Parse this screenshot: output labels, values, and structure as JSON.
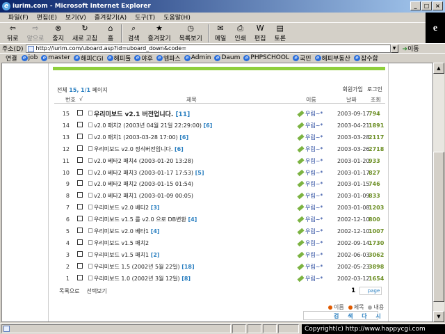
{
  "window": {
    "title": "iurim.com - Microsoft Internet Explorer",
    "icon": "ie-icon"
  },
  "menu": [
    "파일(F)",
    "편집(E)",
    "보기(V)",
    "즐겨찾기(A)",
    "도구(T)",
    "도움말(H)"
  ],
  "toolbar": {
    "back": "뒤로",
    "forward": "앞으로",
    "stop": "중지",
    "refresh": "새로 고침",
    "home": "홈",
    "search": "검색",
    "favorites": "즐겨찾기",
    "history": "목록보기",
    "mail": "메일",
    "print": "인쇄",
    "edit": "편집",
    "discuss": "토론"
  },
  "address": {
    "label": "주소(D)",
    "url": "http://iurim.com/uboard.asp?id=uboard_down&code=",
    "go": "이동"
  },
  "links": {
    "label": "연결",
    "items": [
      "job",
      "master",
      "해피CGI",
      "해피툴",
      "야후",
      "엠파스",
      "Admin",
      "Daum",
      "PHPSCHOOL",
      "국민",
      "해피부동산",
      "잡수함"
    ]
  },
  "board": {
    "summary_prefix": "전체",
    "summary_count": "15,",
    "summary_page": "1/1",
    "summary_suffix": "페이지",
    "top_links": [
      "회원가입",
      "로그인"
    ],
    "headers": {
      "no": "번호",
      "check": "√",
      "subject": "제목",
      "name": "이름",
      "date": "날짜",
      "hit": "조회"
    },
    "rows": [
      {
        "no": "15",
        "subject": "우리미보드 v2.1 버전업니다.",
        "comments": "[11]",
        "name": "우림~*",
        "date": "2003-09-17",
        "hit": "794",
        "bold": true
      },
      {
        "no": "14",
        "subject": "v2.0 패치2 (2003년 04월 21일 22:29:00)",
        "comments": "[6]",
        "name": "우림~*",
        "date": "2003-04-21",
        "hit": "1891"
      },
      {
        "no": "13",
        "subject": "v2.0 패치1 (2003-03-28 17:00)",
        "comments": "[6]",
        "name": "우림~*",
        "date": "2003-03-28",
        "hit": "2117"
      },
      {
        "no": "12",
        "subject": "우리미보드 v2.0 정식버전입니다.",
        "comments": "[6]",
        "name": "우림~*",
        "date": "2003-03-26",
        "hit": "2718"
      },
      {
        "no": "11",
        "subject": "v2.0 베타2 패치4 (2003-01-20 13:28)",
        "comments": "",
        "name": "우림~*",
        "date": "2003-01-20",
        "hit": "933"
      },
      {
        "no": "10",
        "subject": "v2.0 베타2 패치3 (2003-01-17 17:53)",
        "comments": "[5]",
        "name": "우림~*",
        "date": "2003-01-17",
        "hit": "827"
      },
      {
        "no": "9",
        "subject": "v2.0 베타2 패치2 (2003-01-15 01:54)",
        "comments": "",
        "name": "우림~*",
        "date": "2003-01-15",
        "hit": "746"
      },
      {
        "no": "8",
        "subject": "v2.0 베타2 패치1 (2003-01-09 00:05)",
        "comments": "",
        "name": "우림~*",
        "date": "2003-01-09",
        "hit": "833"
      },
      {
        "no": "7",
        "subject": "우리미보드 v2.0 베타2",
        "comments": "[3]",
        "name": "우림~*",
        "date": "2003-01-08",
        "hit": "1203"
      },
      {
        "no": "6",
        "subject": "우리미보드 v1.5 를 v2.0 으로 DB변환",
        "comments": "[4]",
        "name": "우림~*",
        "date": "2002-12-10",
        "hit": "800"
      },
      {
        "no": "5",
        "subject": "우리미보드 v2.0 베타1",
        "comments": "[4]",
        "name": "우림~*",
        "date": "2002-12-10",
        "hit": "1007"
      },
      {
        "no": "4",
        "subject": "우리미보드 v1.5 패치2",
        "comments": "",
        "name": "우림~*",
        "date": "2002-09-14",
        "hit": "1730"
      },
      {
        "no": "3",
        "subject": "우리미보드 v1.5 패치1",
        "comments": "[2]",
        "name": "우림~*",
        "date": "2002-06-03",
        "hit": "3062"
      },
      {
        "no": "2",
        "subject": "우리미보드 1.5 (2002년 5월 22일)",
        "comments": "[18]",
        "name": "우림~*",
        "date": "2002-05-23",
        "hit": "3898"
      },
      {
        "no": "1",
        "subject": "우리미보드 1.0 (2002년 3월 12일)",
        "comments": "[8]",
        "name": "우림~*",
        "date": "2002-03-12",
        "hit": "1654"
      }
    ],
    "bottom_links": [
      "목록으로",
      "선택보기"
    ],
    "page": "1",
    "page_btn": "page",
    "search_opts": [
      "이름",
      "제목",
      "내용"
    ],
    "search_btn": "검 색 다 시"
  },
  "copyright": "Copyright(c) http://www.happycgi.com"
}
